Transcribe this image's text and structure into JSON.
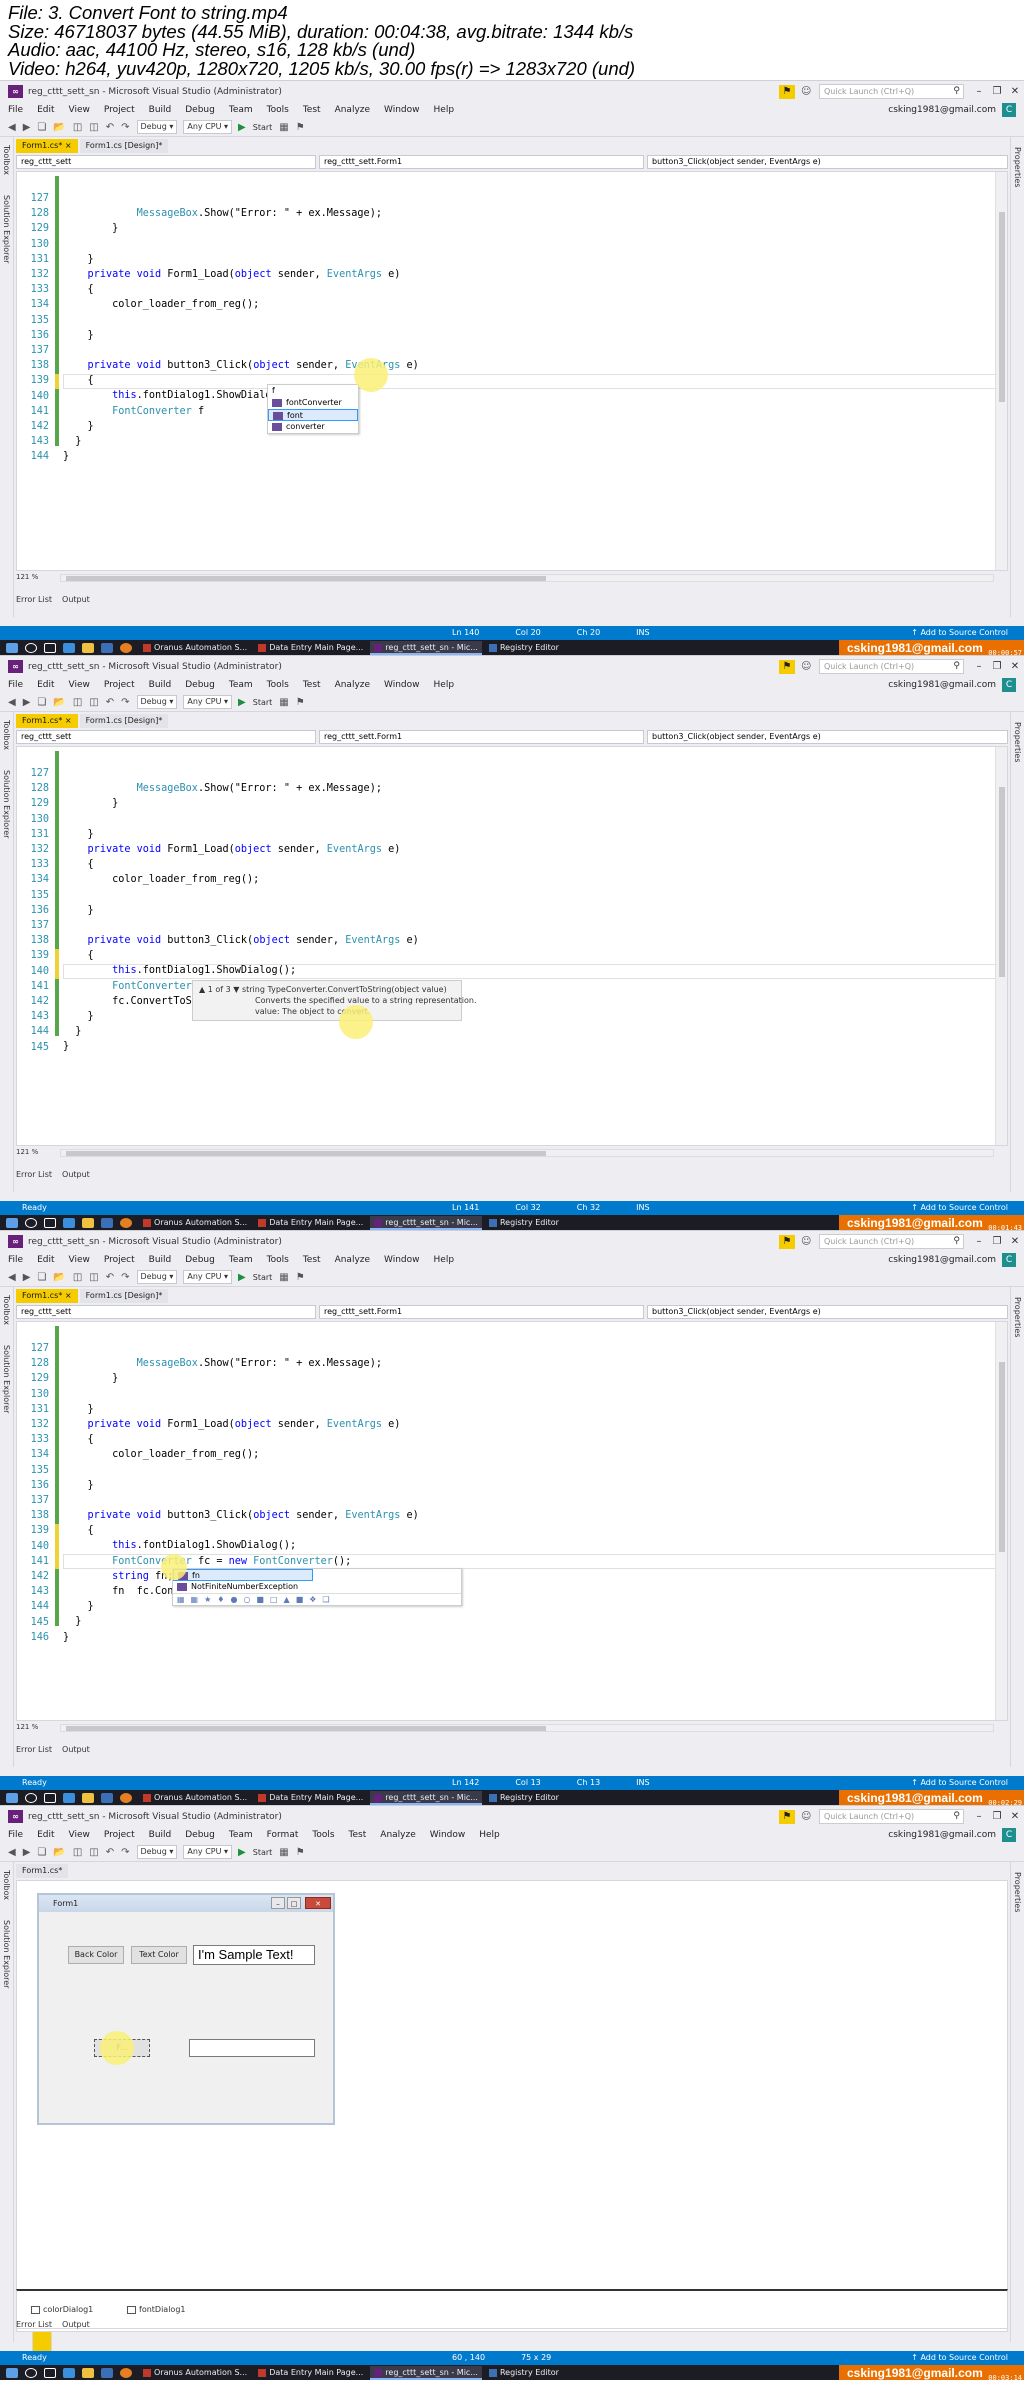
{
  "header": {
    "lines": [
      "File: 3. Convert Font to string.mp4",
      "Size: 46718037 bytes (44.55 MiB), duration: 00:04:38, avg.bitrate: 1344 kb/s",
      "Audio: aac, 44100 Hz, stereo, s16, 128 kb/s (und)",
      "Video: h264, yuv420p, 1280x720, 1205 kb/s, 30.00 fps(r) => 1283x720 (und)"
    ]
  },
  "common": {
    "window_title": "reg_cttt_sett_sn - Microsoft Visual Studio (Administrator)",
    "quick_launch": "Quick Launch (Ctrl+Q)",
    "menu": [
      "File",
      "Edit",
      "View",
      "Project",
      "Build",
      "Debug",
      "Team",
      "Tools",
      "Test",
      "Analyze",
      "Window",
      "Help"
    ],
    "menu_designer": [
      "File",
      "Edit",
      "View",
      "Project",
      "Build",
      "Debug",
      "Team",
      "Format",
      "Tools",
      "Test",
      "Analyze",
      "Window",
      "Help"
    ],
    "user": "csking1981@gmail.com",
    "avatar_letter": "C",
    "config": "Debug",
    "platform": "Any CPU",
    "start": "Start",
    "toolbox_label": "Toolbox",
    "solution_explorer_label": "Solution Explorer",
    "properties_label": "Properties",
    "tab_code": "Form1.cs*",
    "tab_design": "Form1.cs [Design]*",
    "nav_project": "reg_cttt_sett",
    "nav_class": "reg_cttt_sett.Form1",
    "nav_member": "button3_Click(object sender, EventArgs e)",
    "zoom": "121 %",
    "bottom_tabs": [
      "Error List",
      "Output"
    ],
    "status_ready": "Ready",
    "add_source": "Add to Source Control",
    "ins": "INS",
    "email_badge": "csking1981@gmail.com",
    "taskbar_apps": [
      {
        "label": "Oranus Automation S...",
        "color": "#c0392b"
      },
      {
        "label": "Data Entry Main Page...",
        "color": "#c0392b"
      },
      {
        "label": "reg_cttt_sett_sn - Mic...",
        "color": "#68217a"
      },
      {
        "label": "Registry Editor",
        "color": "#3b6fb6"
      }
    ]
  },
  "frames": [
    {
      "title_tabs": [
        "Form1.cs*",
        "Form1.cs [Design]*"
      ],
      "status": {
        "ready": "",
        "ln": "Ln 140",
        "col": "Col 20",
        "ch": "Ch 20"
      },
      "timestamp": "00:00:57",
      "lines": [
        {
          "n": "127",
          "t": "            MessageBox.Show(\"Error: \" + ex.Message);"
        },
        {
          "n": "128",
          "t": "        }"
        },
        {
          "n": "129",
          "t": ""
        },
        {
          "n": "130",
          "t": "    }"
        },
        {
          "n": "131",
          "t": "    private void Form1_Load(object sender, EventArgs e)"
        },
        {
          "n": "132",
          "t": "    {"
        },
        {
          "n": "133",
          "t": "        color_loader_from_reg();"
        },
        {
          "n": "134",
          "t": ""
        },
        {
          "n": "135",
          "t": "    }"
        },
        {
          "n": "136",
          "t": ""
        },
        {
          "n": "137",
          "t": "    private void button3_Click(object sender, EventArgs e)"
        },
        {
          "n": "138",
          "t": "    {"
        },
        {
          "n": "139",
          "t": "        this.fontDialog1.ShowDialog();"
        },
        {
          "n": "140",
          "t": "        FontConverter f"
        },
        {
          "n": "141",
          "t": "    }"
        },
        {
          "n": "142",
          "t": "  }"
        },
        {
          "n": "143",
          "t": "}"
        },
        {
          "n": "144",
          "t": ""
        }
      ],
      "completion": {
        "typed": "f",
        "items": [
          "fontConverter",
          "font",
          "converter"
        ],
        "selected": 1
      }
    },
    {
      "status": {
        "ready": "Ready",
        "ln": "Ln 141",
        "col": "Col 32",
        "ch": "Ch 32"
      },
      "timestamp": "00:01:43",
      "lines": [
        {
          "n": "127",
          "t": "            MessageBox.Show(\"Error: \" + ex.Message);"
        },
        {
          "n": "128",
          "t": "        }"
        },
        {
          "n": "129",
          "t": ""
        },
        {
          "n": "130",
          "t": "    }"
        },
        {
          "n": "131",
          "t": "    private void Form1_Load(object sender, EventArgs e)"
        },
        {
          "n": "132",
          "t": "    {"
        },
        {
          "n": "133",
          "t": "        color_loader_from_reg();"
        },
        {
          "n": "134",
          "t": ""
        },
        {
          "n": "135",
          "t": "    }"
        },
        {
          "n": "136",
          "t": ""
        },
        {
          "n": "137",
          "t": "    private void button3_Click(object sender, EventArgs e)"
        },
        {
          "n": "138",
          "t": "    {"
        },
        {
          "n": "139",
          "t": "        this.fontDialog1.ShowDialog();"
        },
        {
          "n": "140",
          "t": "        FontConverter fc = new FontConverter();"
        },
        {
          "n": "141",
          "t": "        fc.ConvertToString()"
        },
        {
          "n": "142",
          "t": "    }"
        },
        {
          "n": "143",
          "t": "  }"
        },
        {
          "n": "144",
          "t": "}"
        },
        {
          "n": "145",
          "t": ""
        }
      ],
      "signature": {
        "counter": "1 of 3",
        "sig": "string TypeConverter.ConvertToString(object value)",
        "desc": "Converts the specified value to a string representation.",
        "param": "value: The object to convert."
      }
    },
    {
      "status": {
        "ready": "Ready",
        "ln": "Ln 142",
        "col": "Col 13",
        "ch": "Ch 13"
      },
      "timestamp": "00:02:29",
      "lines": [
        {
          "n": "127",
          "t": "            MessageBox.Show(\"Error: \" + ex.Message);"
        },
        {
          "n": "128",
          "t": "        }"
        },
        {
          "n": "129",
          "t": ""
        },
        {
          "n": "130",
          "t": "    }"
        },
        {
          "n": "131",
          "t": "    private void Form1_Load(object sender, EventArgs e)"
        },
        {
          "n": "132",
          "t": "    {"
        },
        {
          "n": "133",
          "t": "        color_loader_from_reg();"
        },
        {
          "n": "134",
          "t": ""
        },
        {
          "n": "135",
          "t": "    }"
        },
        {
          "n": "136",
          "t": ""
        },
        {
          "n": "137",
          "t": "    private void button3_Click(object sender, EventArgs e)"
        },
        {
          "n": "138",
          "t": "    {"
        },
        {
          "n": "139",
          "t": "        this.fontDialog1.ShowDialog();"
        },
        {
          "n": "140",
          "t": "        FontConverter fc = new FontConverter();"
        },
        {
          "n": "141",
          "t": "        string fn;"
        },
        {
          "n": "142",
          "t": "        fn  fc.ConvertToString(this.fontDialog1.Font)"
        },
        {
          "n": "143",
          "t": "    }"
        },
        {
          "n": "144",
          "t": "  }"
        },
        {
          "n": "145",
          "t": "}"
        },
        {
          "n": "146",
          "t": ""
        }
      ],
      "completion": {
        "typed": "fn",
        "items": [
          "fn",
          "NotFiniteNumberException"
        ],
        "selected": 0
      }
    },
    {
      "status": {
        "ready": "Ready",
        "ln": "60 , 140",
        "col": "75 x 29",
        "ch": ""
      },
      "timestamp": "00:03:14",
      "form": {
        "title": "Form1",
        "back_color_btn": "Back Color",
        "text_color_btn": "Text Color",
        "sample_text": "I'm Sample Text!",
        "font_btn": "F..."
      },
      "components": [
        "colorDialog1",
        "fontDialog1"
      ]
    }
  ]
}
